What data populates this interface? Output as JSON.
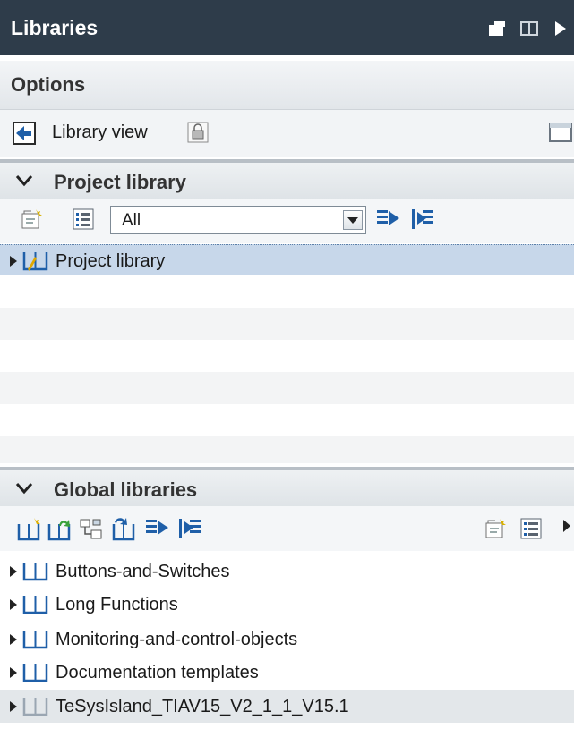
{
  "header": {
    "title": "Libraries"
  },
  "options": {
    "label": "Options",
    "library_view_label": "Library view"
  },
  "project_library": {
    "section_label": "Project library",
    "filter_value": "All",
    "tree": [
      {
        "label": "Project library",
        "selected": true
      }
    ]
  },
  "global_libraries": {
    "section_label": "Global libraries",
    "items": [
      {
        "label": "Buttons-and-Switches"
      },
      {
        "label": "Long Functions"
      },
      {
        "label": "Monitoring-and-control-objects"
      },
      {
        "label": "Documentation templates"
      },
      {
        "label": "TeSysIsland_TIAV15_V2_1_1_V15.1"
      }
    ]
  },
  "colors": {
    "titlebar": "#2e3c4a",
    "selection": "#c7d7ea",
    "accent_green": "#3aa23a",
    "accent_blue": "#1f5fa8"
  }
}
